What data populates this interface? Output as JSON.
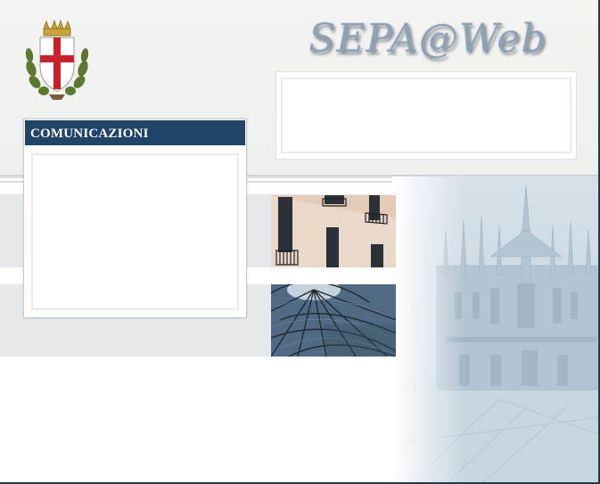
{
  "app": {
    "logo_text": "SEPA@Web"
  },
  "header": {
    "crest_icon": "milan-coat-of-arms-icon"
  },
  "communications": {
    "title": "COMUNICAZIONI",
    "items": []
  },
  "images": {
    "building": "building-facade-photo",
    "dome": "galleria-glass-dome-photo",
    "cathedral": "duomo-cathedral-background"
  },
  "colors": {
    "header_bg": "#1f4468",
    "logo": "#8fa2b5",
    "band": "#e6e9ec"
  }
}
